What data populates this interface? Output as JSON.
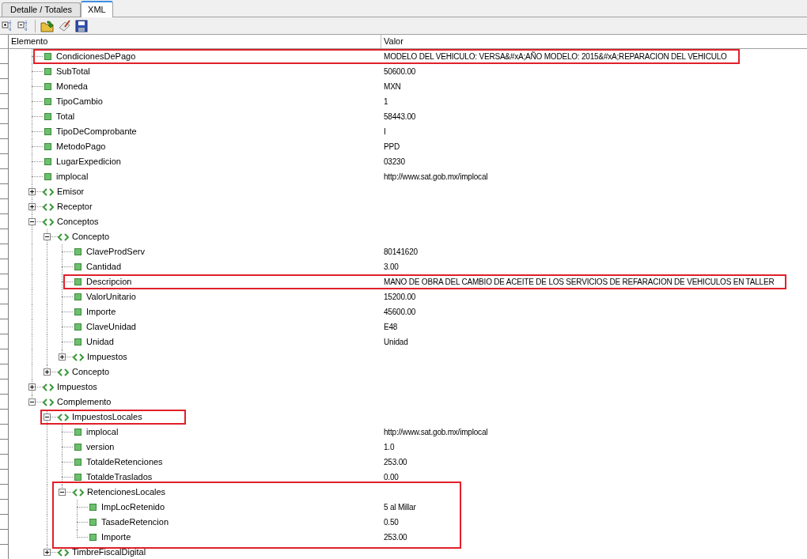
{
  "tabs": [
    {
      "label": "Detalle / Totales",
      "selected": false
    },
    {
      "label": "XML",
      "selected": true
    }
  ],
  "columns": [
    "Elemento",
    "Valor"
  ],
  "tree": [
    {
      "kind": "attribute",
      "name": "CondicionesDePago",
      "value": "MODELO DEL VEHICULO: VERSA&#xA;AÑO MODELO: 2015&#xA;REPARACION DEL VEHICULO",
      "highlighted": true
    },
    {
      "kind": "attribute",
      "name": "SubTotal",
      "value": "50600.00"
    },
    {
      "kind": "attribute",
      "name": "Moneda",
      "value": "MXN"
    },
    {
      "kind": "attribute",
      "name": "TipoCambio",
      "value": "1"
    },
    {
      "kind": "attribute",
      "name": "Total",
      "value": "58443.00"
    },
    {
      "kind": "attribute",
      "name": "TipoDeComprobante",
      "value": "I"
    },
    {
      "kind": "attribute",
      "name": "MetodoPago",
      "value": "PPD"
    },
    {
      "kind": "attribute",
      "name": "LugarExpedicion",
      "value": "03230"
    },
    {
      "kind": "attribute",
      "name": "implocal",
      "value": "http://www.sat.gob.mx/implocal"
    },
    {
      "kind": "element",
      "name": "Emisor",
      "expanded": false
    },
    {
      "kind": "element",
      "name": "Receptor",
      "expanded": false
    },
    {
      "kind": "element",
      "name": "Conceptos",
      "expanded": true,
      "children": [
        {
          "kind": "element",
          "name": "Concepto",
          "expanded": true,
          "children": [
            {
              "kind": "attribute",
              "name": "ClaveProdServ",
              "value": "80141620"
            },
            {
              "kind": "attribute",
              "name": "Cantidad",
              "value": "3.00"
            },
            {
              "kind": "attribute",
              "name": "Descripcion",
              "value": "MANO DE OBRA DEL CAMBIO DE ACEITE DE LOS SERVICIOS DE REFARACION DE VEHICULOS EN TALLER",
              "highlighted": true
            },
            {
              "kind": "attribute",
              "name": "ValorUnitario",
              "value": "15200.00"
            },
            {
              "kind": "attribute",
              "name": "Importe",
              "value": "45600.00"
            },
            {
              "kind": "attribute",
              "name": "ClaveUnidad",
              "value": "E48"
            },
            {
              "kind": "attribute",
              "name": "Unidad",
              "value": "Unidad"
            },
            {
              "kind": "element",
              "name": "Impuestos",
              "expanded": false
            }
          ]
        },
        {
          "kind": "element",
          "name": "Concepto",
          "expanded": false
        }
      ]
    },
    {
      "kind": "element",
      "name": "Impuestos",
      "expanded": false
    },
    {
      "kind": "element",
      "name": "Complemento",
      "expanded": true,
      "children": [
        {
          "kind": "element",
          "name": "ImpuestosLocales",
          "expanded": true,
          "highlighted": true,
          "children": [
            {
              "kind": "attribute",
              "name": "implocal",
              "value": "http://www.sat.gob.mx/implocal"
            },
            {
              "kind": "attribute",
              "name": "version",
              "value": "1.0"
            },
            {
              "kind": "attribute",
              "name": "TotaldeRetenciones",
              "value": "253.00"
            },
            {
              "kind": "attribute",
              "name": "TotaldeTraslados",
              "value": "0.00"
            },
            {
              "kind": "element",
              "name": "RetencionesLocales",
              "expanded": true,
              "group_highlighted": true,
              "children": [
                {
                  "kind": "attribute",
                  "name": "ImpLocRetenido",
                  "value": "5 al Millar"
                },
                {
                  "kind": "attribute",
                  "name": "TasadeRetencion",
                  "value": "0.50"
                },
                {
                  "kind": "attribute",
                  "name": "Importe",
                  "value": "253.00"
                }
              ]
            }
          ]
        },
        {
          "kind": "element",
          "name": "TimbreFiscalDigital",
          "expanded": false
        }
      ]
    }
  ]
}
